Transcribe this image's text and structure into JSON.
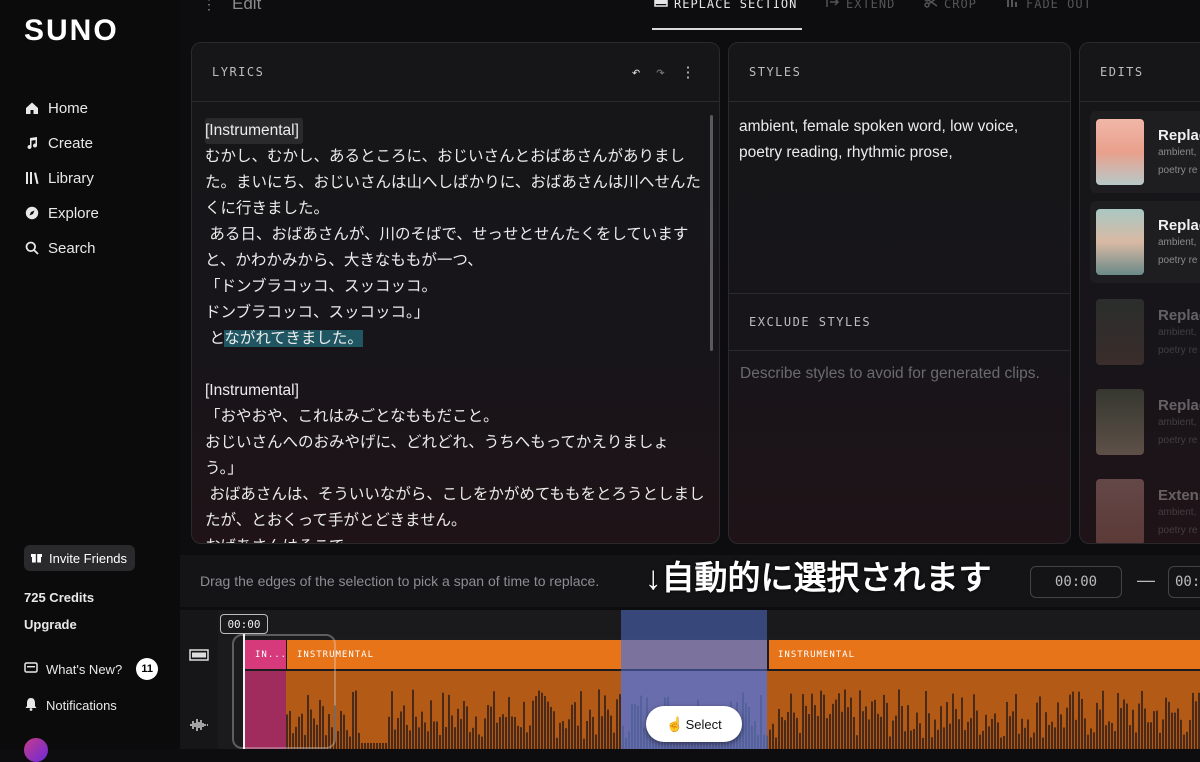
{
  "app": {
    "logo": "SUNO"
  },
  "sidebar": {
    "items": [
      {
        "label": "Home",
        "icon": "home-icon"
      },
      {
        "label": "Create",
        "icon": "music-note-icon"
      },
      {
        "label": "Library",
        "icon": "library-icon"
      },
      {
        "label": "Explore",
        "icon": "compass-icon"
      },
      {
        "label": "Search",
        "icon": "search-icon"
      }
    ],
    "invite_label": "Invite Friends",
    "credits": "725 Credits",
    "upgrade": "Upgrade",
    "whats_new": "What's New?",
    "whats_new_count": "11",
    "notifications": "Notifications"
  },
  "topbar": {
    "title": "Edit",
    "tabs": [
      {
        "label": "REPLACE SECTION",
        "active": true
      },
      {
        "label": "EXTEND",
        "active": false
      },
      {
        "label": "CROP",
        "active": false
      },
      {
        "label": "FADE OUT",
        "active": false
      }
    ]
  },
  "lyrics": {
    "header": "LYRICS",
    "line1_tag": "[Instrumental]",
    "para1": "むかし、むかし、あるところに、おじいさんとおばあさんがありました。まいにち、おじいさんは山へしばかりに、おばあさんは川へせんたくに行きました。\n ある日、おばあさんが、川のそばで、せっせとせんたくをしていますと、かわかみから、大きなももが一つ、\n「ドンブラコッコ、スッコッコ。\nドンブラコッコ、スッコッコ。」\n と",
    "para1_highlight": "ながれてきました。",
    "line2_tag": "[Instrumental]",
    "para2": "「おやおや、これはみごとなももだこと。\nおじいさんへのおみやげに、どれどれ、うちへもってかえりましょう。」\n おばあさんは、そういいながら、こしをかがめてももをとろうとしましたが、とおくって手がとどきません。\nおばあさんはそこで、\n「アッチノミイズ ワ、カアライゾ。"
  },
  "styles": {
    "header": "STYLES",
    "value": "ambient, female spoken word, low voice, poetry reading, rhythmic prose,",
    "exclude_header": "EXCLUDE STYLES",
    "exclude_placeholder": "Describe styles to avoid for generated clips."
  },
  "edits": {
    "header": "EDITS",
    "items": [
      {
        "title": "Replac",
        "sub1": "ambient,",
        "sub2": "poetry re"
      },
      {
        "title": "Replac",
        "sub1": "ambient,",
        "sub2": "poetry re"
      },
      {
        "title": "Replac",
        "sub1": "ambient,",
        "sub2": "poetry re"
      },
      {
        "title": "Replac",
        "sub1": "ambient,",
        "sub2": "poetry re"
      },
      {
        "title": "Extens",
        "sub1": "ambient,",
        "sub2": "poetry re"
      }
    ]
  },
  "timeline": {
    "hint": "Drag the edges of the selection to pick a span of time to replace.",
    "overlay_caption": "↓自動的に選択されます",
    "start_time": "00:00",
    "end_time_partial": "00:",
    "playhead_time": "00:00",
    "lane_labels": [
      "IN...",
      "INSTRUMENTAL",
      "INSTRUMENTAL"
    ],
    "select_button": "Select"
  },
  "colors": {
    "accent_orange": "#e8741a",
    "accent_pink": "#d63a7a",
    "selection_blue": "#506ec8",
    "highlight_teal": "#1f5661"
  }
}
